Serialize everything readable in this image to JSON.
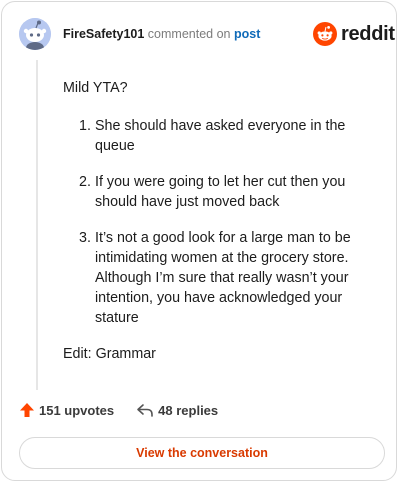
{
  "comment": {
    "username": "FireSafety101",
    "action_text": "commented on",
    "target_text": "post",
    "intro": "Mild YTA?",
    "items": [
      {
        "number": "1.",
        "text": "She should have asked everyone in the queue"
      },
      {
        "number": "2.",
        "text": "If you were going to let her cut then you should have just moved back"
      },
      {
        "number": "3.",
        "text": "It’s not a good look for a large man to be intimidating women at the grocery store. Although I’m sure that really wasn’t your intention, you have acknowledged your stature"
      }
    ],
    "edit_note": "Edit: Grammar"
  },
  "brand": {
    "name": "reddit",
    "accent_color": "#ff4500"
  },
  "stats": {
    "upvotes": "151 upvotes",
    "replies": "48 replies"
  },
  "cta": {
    "label": "View the conversation"
  },
  "icons": {
    "avatar": "snoo-avatar-icon",
    "logo": "reddit-alien-icon",
    "upvote": "upvote-arrow-icon",
    "reply": "reply-arrow-icon"
  }
}
